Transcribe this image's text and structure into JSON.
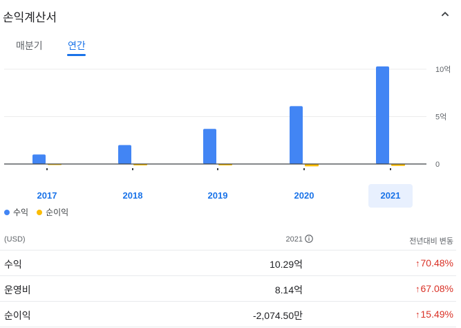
{
  "title": "손익계산서",
  "tabs": [
    {
      "label": "매분기",
      "active": false
    },
    {
      "label": "연간",
      "active": true
    }
  ],
  "y_axis_labels": [
    "10억",
    "5억",
    "0"
  ],
  "legend": [
    {
      "label": "수익",
      "color": "#4285f4"
    },
    {
      "label": "순이익",
      "color": "#fbbc04"
    }
  ],
  "chart_data": {
    "type": "bar",
    "categories": [
      "2017",
      "2018",
      "2019",
      "2020",
      "2021"
    ],
    "selected_category": "2021",
    "ylim": [
      0,
      10
    ],
    "y_unit": "억",
    "series": [
      {
        "name": "수익",
        "color": "#4285f4",
        "values": [
          1.0,
          2.0,
          3.7,
          6.1,
          10.29
        ]
      },
      {
        "name": "순이익",
        "color": "#fbbc04",
        "values": [
          -0.05,
          -0.15,
          -0.15,
          -0.25,
          -0.2
        ]
      }
    ]
  },
  "table": {
    "header": {
      "currency": "(USD)",
      "year": "2021",
      "change": "전년대비 변동"
    },
    "rows": [
      {
        "label": "수익",
        "value": "10.29억",
        "change": "70.48%"
      },
      {
        "label": "운영비",
        "value": "8.14억",
        "change": "67.08%"
      },
      {
        "label": "순이익",
        "value": "-2,074.50만",
        "change": "15.49%"
      }
    ]
  }
}
